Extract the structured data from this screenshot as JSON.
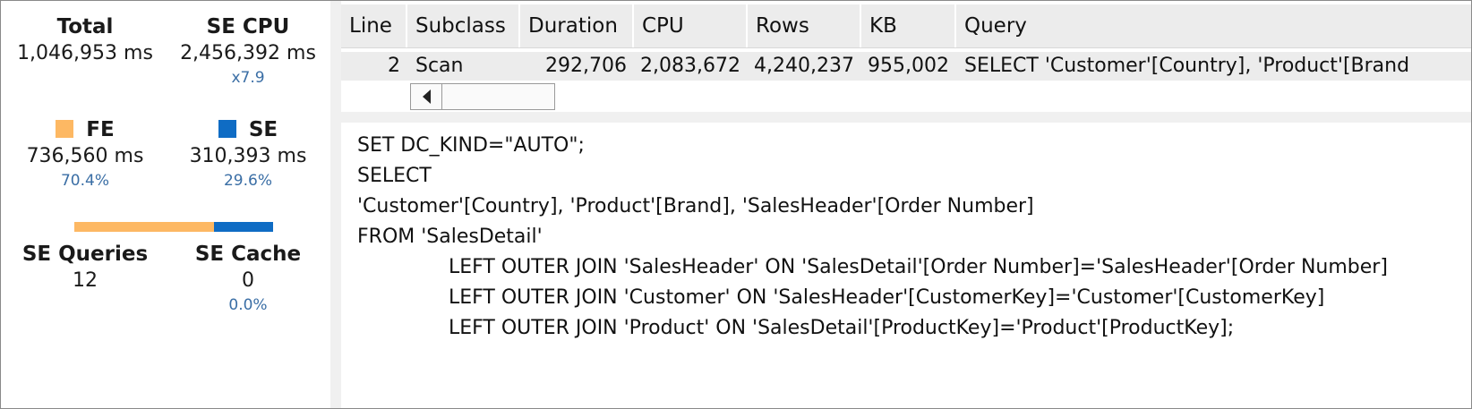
{
  "summary": {
    "total": {
      "label": "Total",
      "value": "1,046,953 ms"
    },
    "se_cpu": {
      "label": "SE CPU",
      "value": "2,456,392 ms",
      "ratio": "x7.9"
    },
    "fe": {
      "label": "FE",
      "value": "736,560 ms",
      "percent": "70.4%",
      "color": "#fdb863",
      "fraction": 0.704
    },
    "se": {
      "label": "SE",
      "value": "310,393 ms",
      "percent": "29.6%",
      "color": "#0f6cc4",
      "fraction": 0.296
    },
    "se_queries": {
      "label": "SE Queries",
      "value": "12"
    },
    "se_cache": {
      "label": "SE Cache",
      "value": "0",
      "percent": "0.0%"
    }
  },
  "grid": {
    "columns": [
      "Line",
      "Subclass",
      "Duration",
      "CPU",
      "Rows",
      "KB",
      "Query"
    ],
    "rows": [
      {
        "line": "2",
        "subclass": "Scan",
        "duration": "292,706",
        "cpu": "2,083,672",
        "rows": "4,240,237",
        "kb": "955,002",
        "query": "SELECT 'Customer'[Country], 'Product'[Brand"
      }
    ]
  },
  "query_text": {
    "lines": [
      "SET DC_KIND=\"AUTO\";",
      "SELECT",
      "'Customer'[Country], 'Product'[Brand], 'SalesHeader'[Order Number]",
      "FROM 'SalesDetail'",
      "LEFT OUTER JOIN 'SalesHeader' ON 'SalesDetail'[Order Number]='SalesHeader'[Order Number]",
      "LEFT OUTER JOIN 'Customer' ON 'SalesHeader'[CustomerKey]='Customer'[CustomerKey]",
      "LEFT OUTER JOIN 'Product' ON 'SalesDetail'[ProductKey]='Product'[ProductKey];"
    ]
  }
}
